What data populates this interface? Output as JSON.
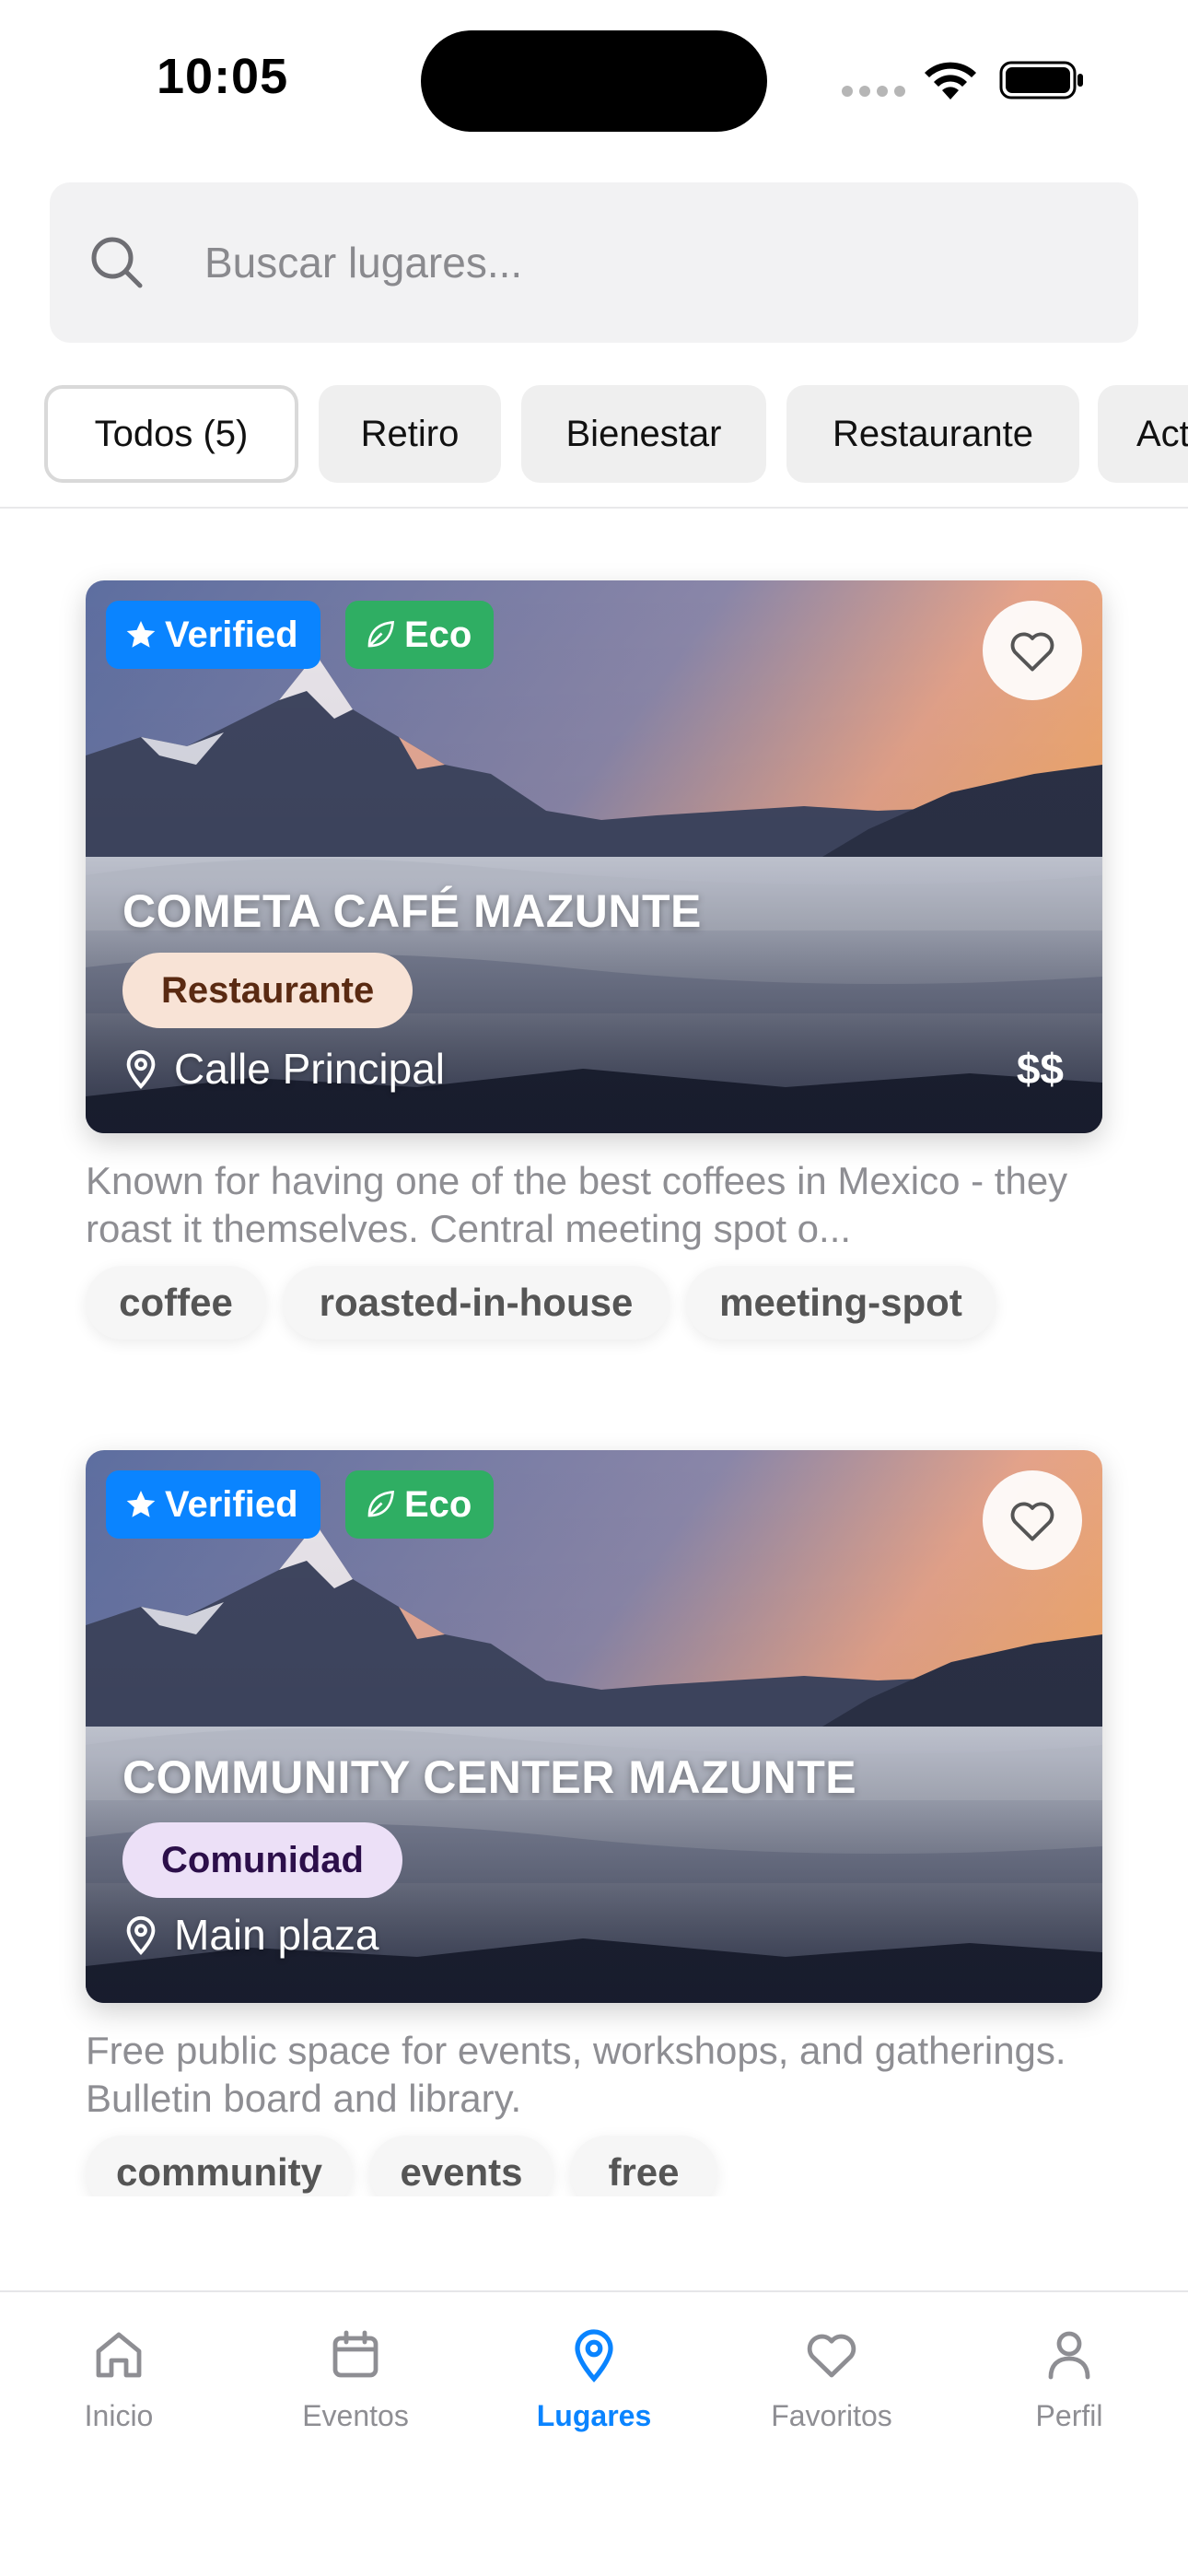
{
  "status_bar": {
    "time": "10:05"
  },
  "search": {
    "placeholder": "Buscar lugares...",
    "value": ""
  },
  "filters": [
    "Todos (5)",
    "Retiro",
    "Bienestar",
    "Restaurante",
    "Actividad"
  ],
  "places": [
    {
      "badges": {
        "verified": "Verified",
        "eco": "Eco"
      },
      "title": "COMETA CAFÉ MAZUNTE",
      "category": "Restaurante",
      "category_bg": "#f8e3d6",
      "category_fg": "#5a2a12",
      "location": "Calle Principal",
      "price": "$$",
      "description": "Known for having one of the best coffees in Mexico - they roast it themselves. Central meeting spot o...",
      "tags": [
        "coffee",
        "roasted-in-house",
        "meeting-spot"
      ]
    },
    {
      "badges": {
        "verified": "Verified",
        "eco": "Eco"
      },
      "title": "COMMUNITY CENTER MAZUNTE",
      "category": "Comunidad",
      "category_bg": "#ece0f7",
      "category_fg": "#2c0f4a",
      "location": "Main plaza",
      "price": "",
      "description": "Free public space for events, workshops, and gatherings. Bulletin board and library.",
      "tags": [
        "community",
        "events",
        "free"
      ]
    }
  ],
  "tabbar": {
    "items": [
      {
        "label": "Inicio",
        "icon": "home-icon"
      },
      {
        "label": "Eventos",
        "icon": "calendar-icon"
      },
      {
        "label": "Lugares",
        "icon": "map-pin-icon",
        "active": true
      },
      {
        "label": "Favoritos",
        "icon": "heart-icon"
      },
      {
        "label": "Perfil",
        "icon": "person-icon"
      }
    ]
  },
  "colors": {
    "accent": "#0a84ff",
    "verified": "#0a84ff",
    "eco": "#2fae63"
  }
}
